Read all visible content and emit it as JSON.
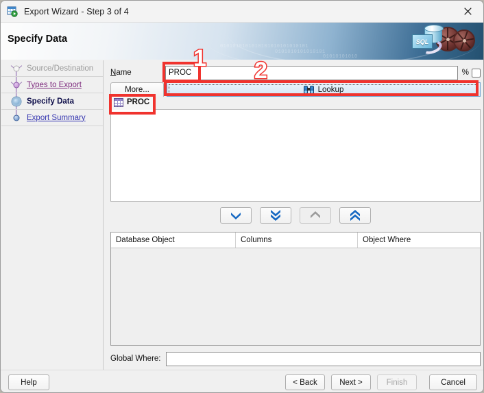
{
  "window": {
    "title": "Export Wizard - Step 3 of 4",
    "app_icon": "export-grid-icon",
    "close_icon": "✕"
  },
  "header": {
    "title": "Specify Data",
    "banner_label": "SQL",
    "binary_text_1": "0101010101010101010101010101",
    "binary_text_2": "01010101010",
    "binary_text_3": "0101010101010101"
  },
  "sidebar": {
    "items": [
      {
        "label": "Source/Destination",
        "state": "done",
        "icon": "node-gray-icon"
      },
      {
        "label": "Types to Export",
        "state": "link",
        "icon": "node-purple-icon"
      },
      {
        "label": "Specify Data",
        "state": "current",
        "icon": "node-current-icon"
      },
      {
        "label": "Export Summary",
        "state": "pending",
        "icon": "node-blue-icon"
      }
    ]
  },
  "main": {
    "name_label": "Name",
    "name_label_accel": "N",
    "name_label_rest": "ame",
    "name_value": "PROC",
    "name_placeholder": "",
    "percent_label": "%",
    "percent_checked": false,
    "more_tab_label": "More...",
    "lookup_label": "Lookup",
    "lookup_icon": "binoculars-icon",
    "object_tab_label": "PROC",
    "object_tab_icon": "table-grid-icon",
    "arrow_buttons": [
      {
        "name": "move-down-button",
        "icon": "chevron-down-icon",
        "enabled": true
      },
      {
        "name": "move-down-all-button",
        "icon": "chevron-double-down-icon",
        "enabled": true
      },
      {
        "name": "move-up-button",
        "icon": "chevron-up-icon",
        "enabled": false
      },
      {
        "name": "move-up-all-button",
        "icon": "chevron-double-up-icon",
        "enabled": true
      }
    ],
    "table": {
      "columns": [
        "Database Object",
        "Columns",
        "Object Where"
      ],
      "rows": []
    },
    "global_where_label": "Global Where:",
    "global_where_value": "",
    "global_where_placeholder": ""
  },
  "footer": {
    "help": "Help",
    "back": "< Back",
    "next": "Next >",
    "finish": "Finish",
    "cancel": "Cancel",
    "finish_enabled": false
  },
  "annotations": {
    "marker_1": "1",
    "marker_2": "2",
    "color": "#f0332e"
  }
}
